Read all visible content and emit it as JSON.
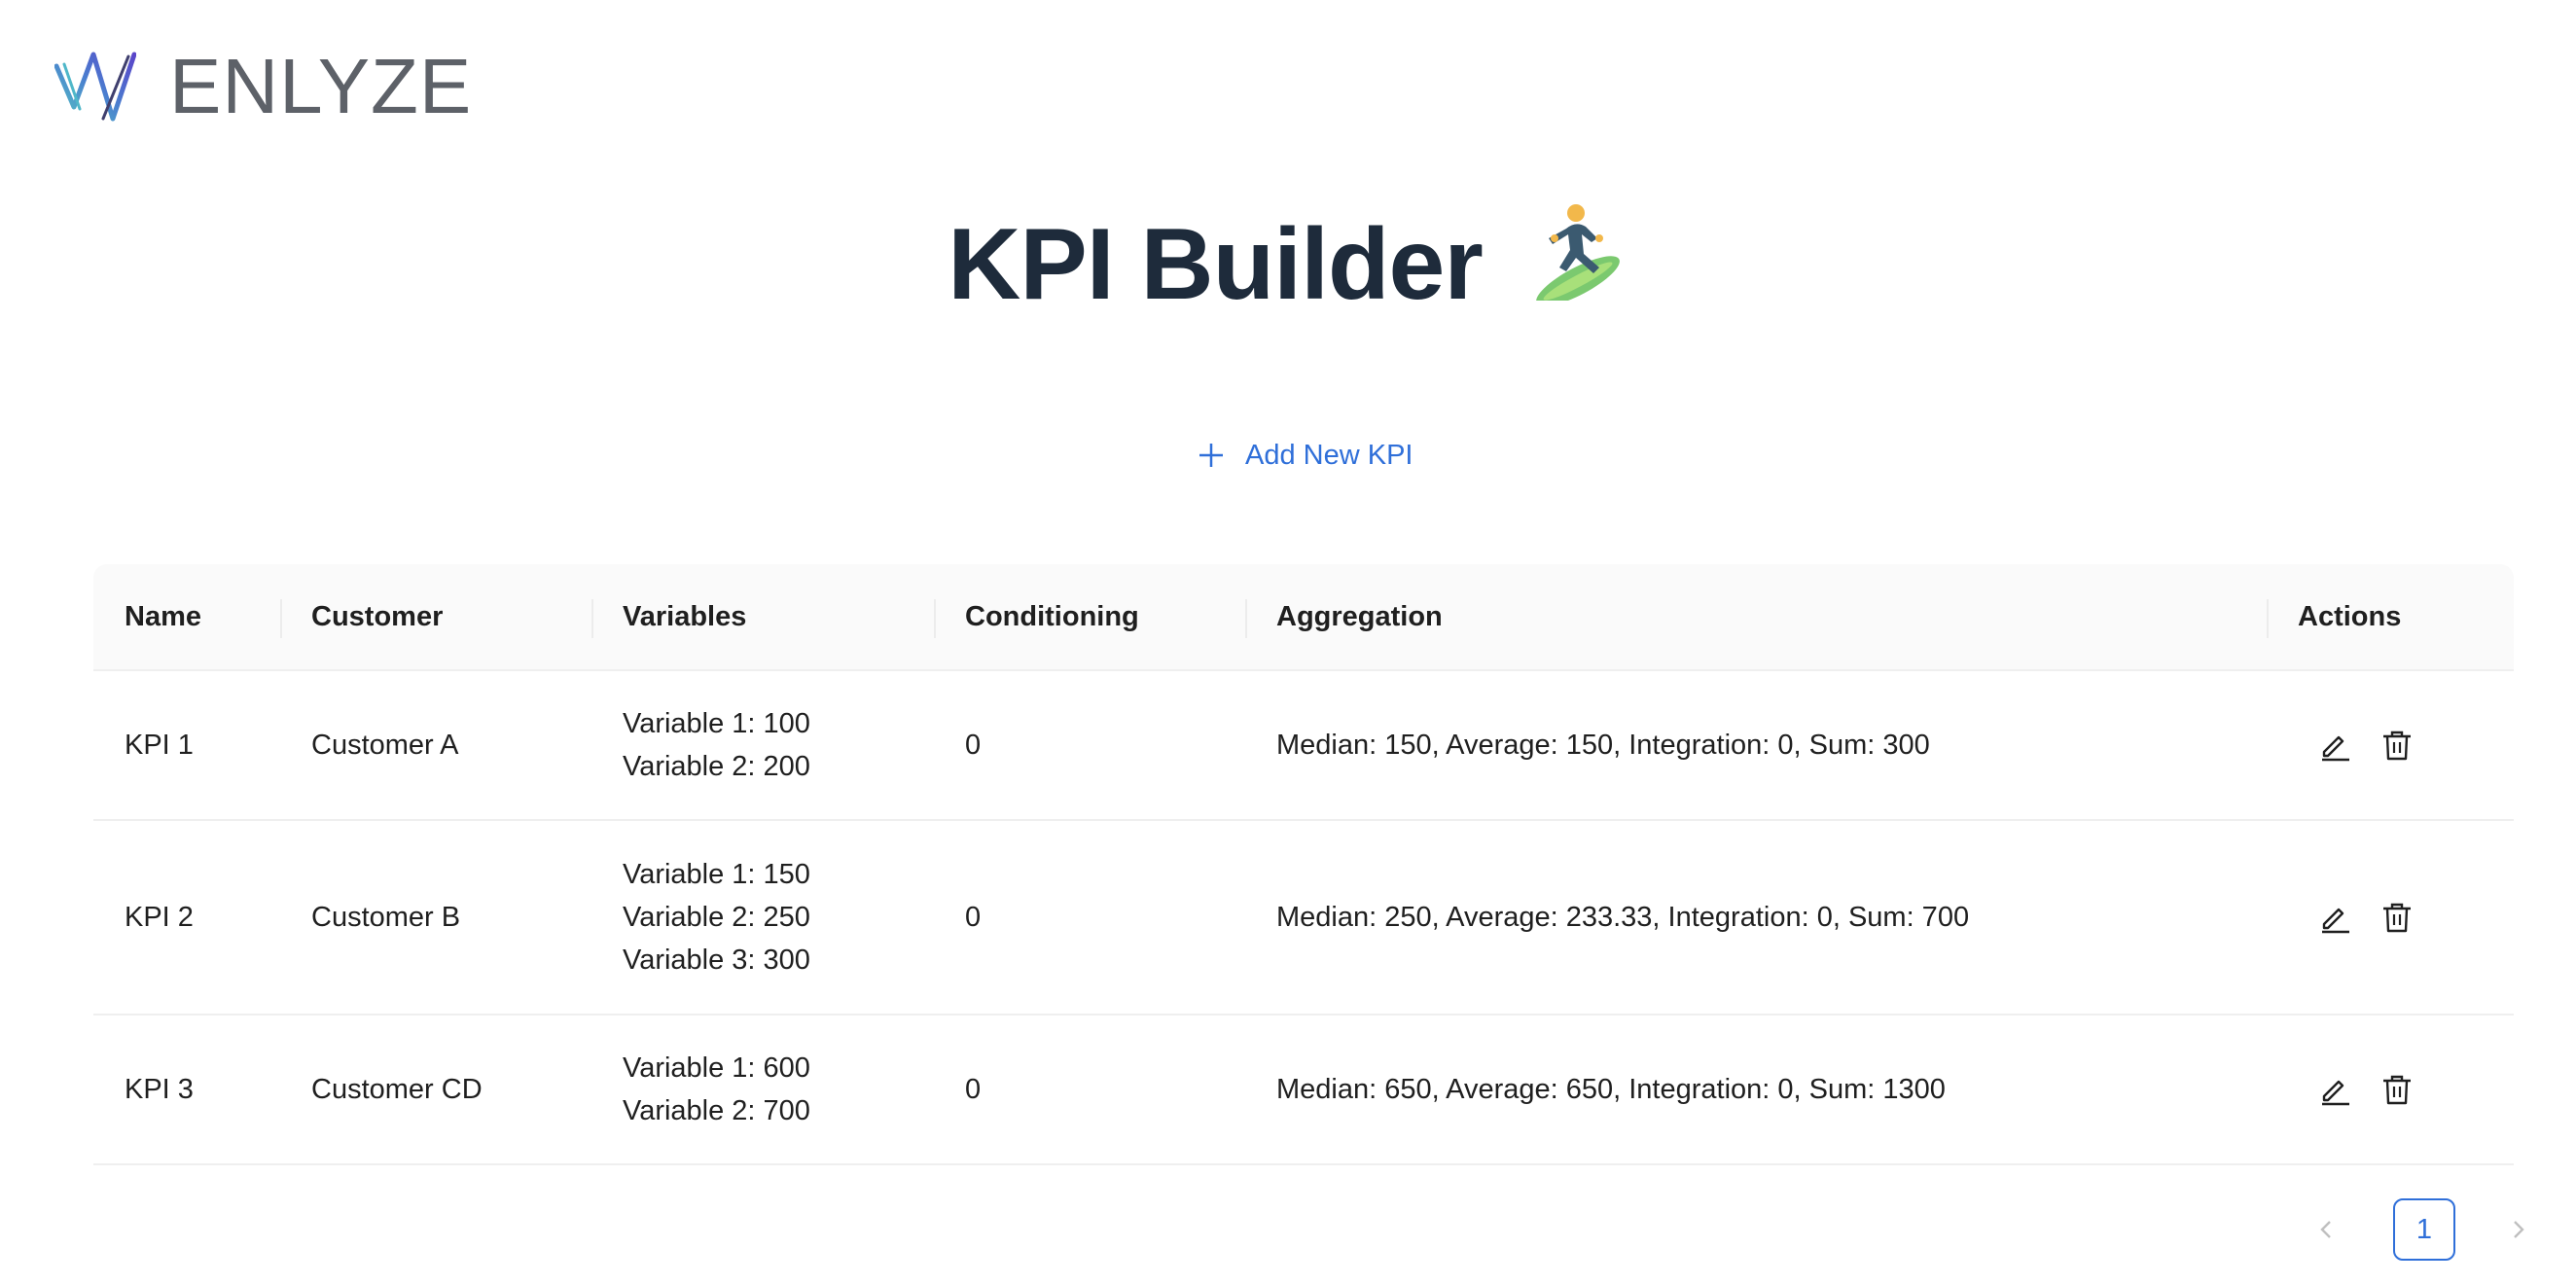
{
  "brand": {
    "name": "ENLYZE"
  },
  "page": {
    "title": "KPI Builder",
    "add_button_label": "Add New KPI"
  },
  "table": {
    "columns": [
      "Name",
      "Customer",
      "Variables",
      "Conditioning",
      "Aggregation",
      "Actions"
    ],
    "rows": [
      {
        "name": "KPI 1",
        "customer": "Customer A",
        "variables": [
          "Variable 1: 100",
          "Variable 2: 200"
        ],
        "conditioning": "0",
        "aggregation": "Median: 150, Average: 150, Integration: 0, Sum: 300"
      },
      {
        "name": "KPI 2",
        "customer": "Customer B",
        "variables": [
          "Variable 1: 150",
          "Variable 2: 250",
          "Variable 3: 300"
        ],
        "conditioning": "0",
        "aggregation": "Median: 250, Average: 233.33, Integration: 0, Sum: 700"
      },
      {
        "name": "KPI 3",
        "customer": "Customer CD",
        "variables": [
          "Variable 1: 600",
          "Variable 2: 700"
        ],
        "conditioning": "0",
        "aggregation": "Median: 650, Average: 650, Integration: 0, Sum: 1300"
      }
    ]
  },
  "pagination": {
    "current_page": "1"
  },
  "colors": {
    "accent": "#2f6fd9",
    "title": "#1e2b3b",
    "header_bg": "#fafafa"
  },
  "icons": {
    "brand": "enlyze-logo-icon",
    "title_emoji": "surfer-icon",
    "add": "plus-icon",
    "edit": "pencil-icon",
    "delete": "trash-icon",
    "prev": "chevron-left-icon",
    "next": "chevron-right-icon"
  }
}
